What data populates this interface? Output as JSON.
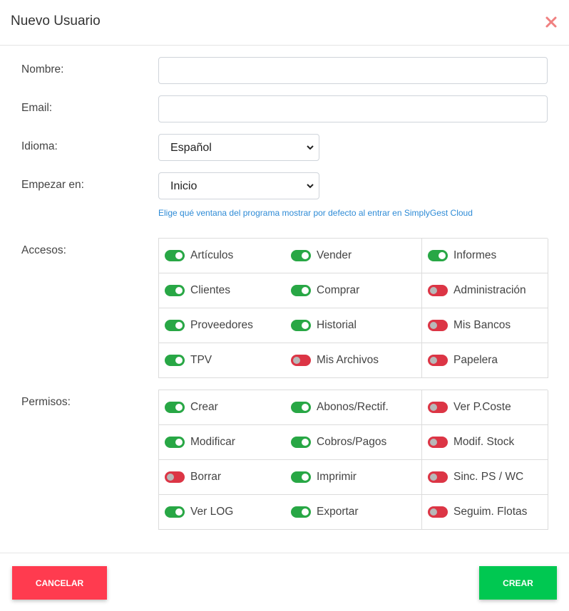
{
  "modal": {
    "title": "Nuevo Usuario",
    "close_icon": "close-icon"
  },
  "form": {
    "name_label": "Nombre:",
    "name_value": "",
    "email_label": "Email:",
    "email_value": "",
    "language_label": "Idioma:",
    "language_value": "Español",
    "start_label": "Empezar en:",
    "start_value": "Inicio",
    "start_help": "Elige qué ventana del programa mostrar por defecto al entrar en SimplyGest Cloud"
  },
  "accesos": {
    "label": "Accesos:",
    "items": [
      {
        "label": "Artículos",
        "on": true
      },
      {
        "label": "Vender",
        "on": true
      },
      {
        "label": "Informes",
        "on": true
      },
      {
        "label": "Clientes",
        "on": true
      },
      {
        "label": "Comprar",
        "on": true
      },
      {
        "label": "Administración",
        "on": false
      },
      {
        "label": "Proveedores",
        "on": true
      },
      {
        "label": "Historial",
        "on": true
      },
      {
        "label": "Mis Bancos",
        "on": false
      },
      {
        "label": "TPV",
        "on": true
      },
      {
        "label": "Mis Archivos",
        "on": false
      },
      {
        "label": "Papelera",
        "on": false
      }
    ]
  },
  "permisos": {
    "label": "Permisos:",
    "items": [
      {
        "label": "Crear",
        "on": true
      },
      {
        "label": "Abonos/Rectif.",
        "on": true
      },
      {
        "label": "Ver P.Coste",
        "on": false
      },
      {
        "label": "Modificar",
        "on": true
      },
      {
        "label": "Cobros/Pagos",
        "on": true
      },
      {
        "label": "Modif. Stock",
        "on": false
      },
      {
        "label": "Borrar",
        "on": false
      },
      {
        "label": "Imprimir",
        "on": true
      },
      {
        "label": "Sinc. PS / WC",
        "on": false
      },
      {
        "label": "Ver LOG",
        "on": true
      },
      {
        "label": "Exportar",
        "on": true
      },
      {
        "label": "Seguim. Flotas",
        "on": false
      }
    ]
  },
  "footer": {
    "cancel_label": "CANCELAR",
    "create_label": "CREAR"
  },
  "colors": {
    "toggle_on": "#28a745",
    "toggle_off": "#dc3545",
    "cancel_button": "#ff3b4f",
    "create_button": "#00c851",
    "help_text": "#2e8bd6",
    "close_icon": "#f08080"
  }
}
